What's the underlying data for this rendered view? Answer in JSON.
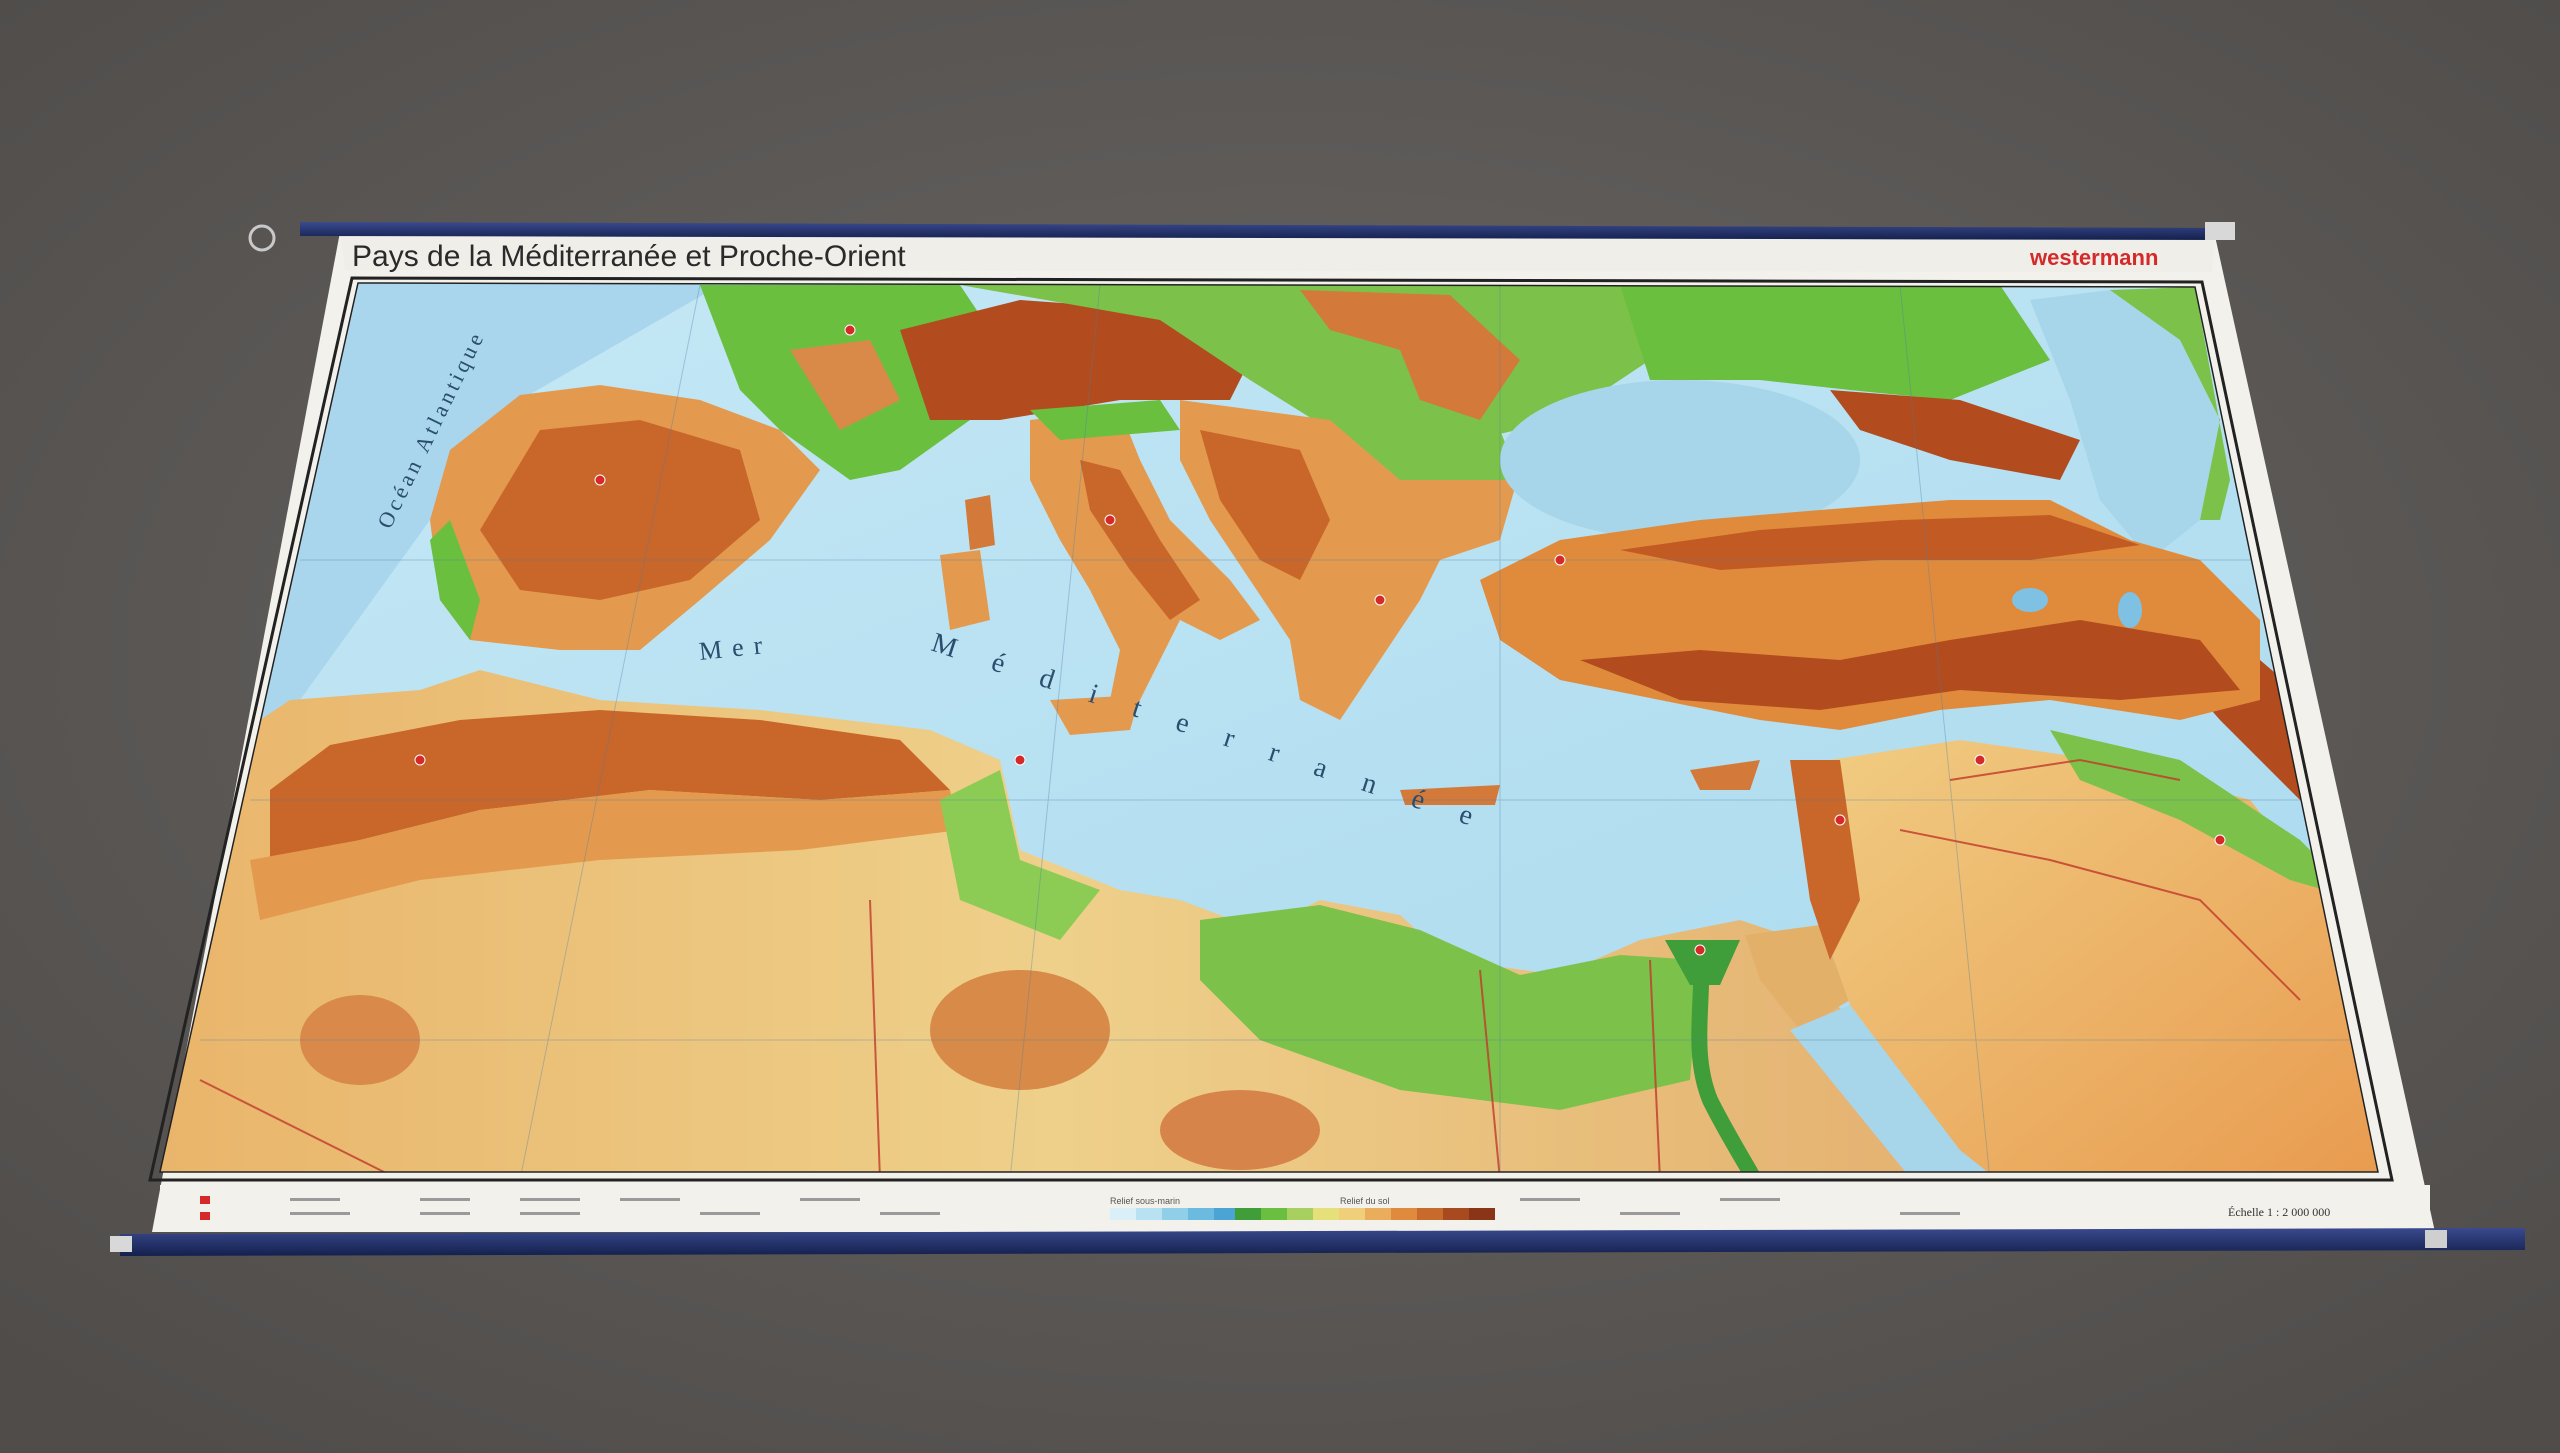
{
  "map": {
    "title": "Pays de la Méditerranée et Proche-Orient",
    "publisher": "westermann",
    "labels": {
      "ocean": "Océan Atlantique",
      "sea_word1": "Mer",
      "sea_word2": "Méditerranée"
    }
  },
  "legend": {
    "relief_sous_marin": "Relief sous-marin",
    "relief_du_sol": "Relief du sol",
    "scale": "Échelle 1 : 2 000 000"
  },
  "colors": {
    "sea": "#b8dff0",
    "lowland": "#6bbf3f",
    "plain": "#c9d87a",
    "desert": "#ecc67f",
    "highland": "#e08b3c",
    "mountain": "#b24b1e",
    "rod": "#1f2f6e",
    "publisher_red": "#d42a2a",
    "asphalt": "#5d5a58"
  },
  "legend_swatches": {
    "sea_steps": [
      "#d9f0f8",
      "#b8e2f2",
      "#90cfe8",
      "#6bbbe0",
      "#4aa4d4"
    ],
    "land_steps": [
      "#3f9d3a",
      "#6bbf3f",
      "#a8d060",
      "#e6e07a",
      "#f0cf7a",
      "#e9ad5c",
      "#df8a3c",
      "#c86a2c",
      "#a84a20",
      "#8a3418"
    ]
  }
}
